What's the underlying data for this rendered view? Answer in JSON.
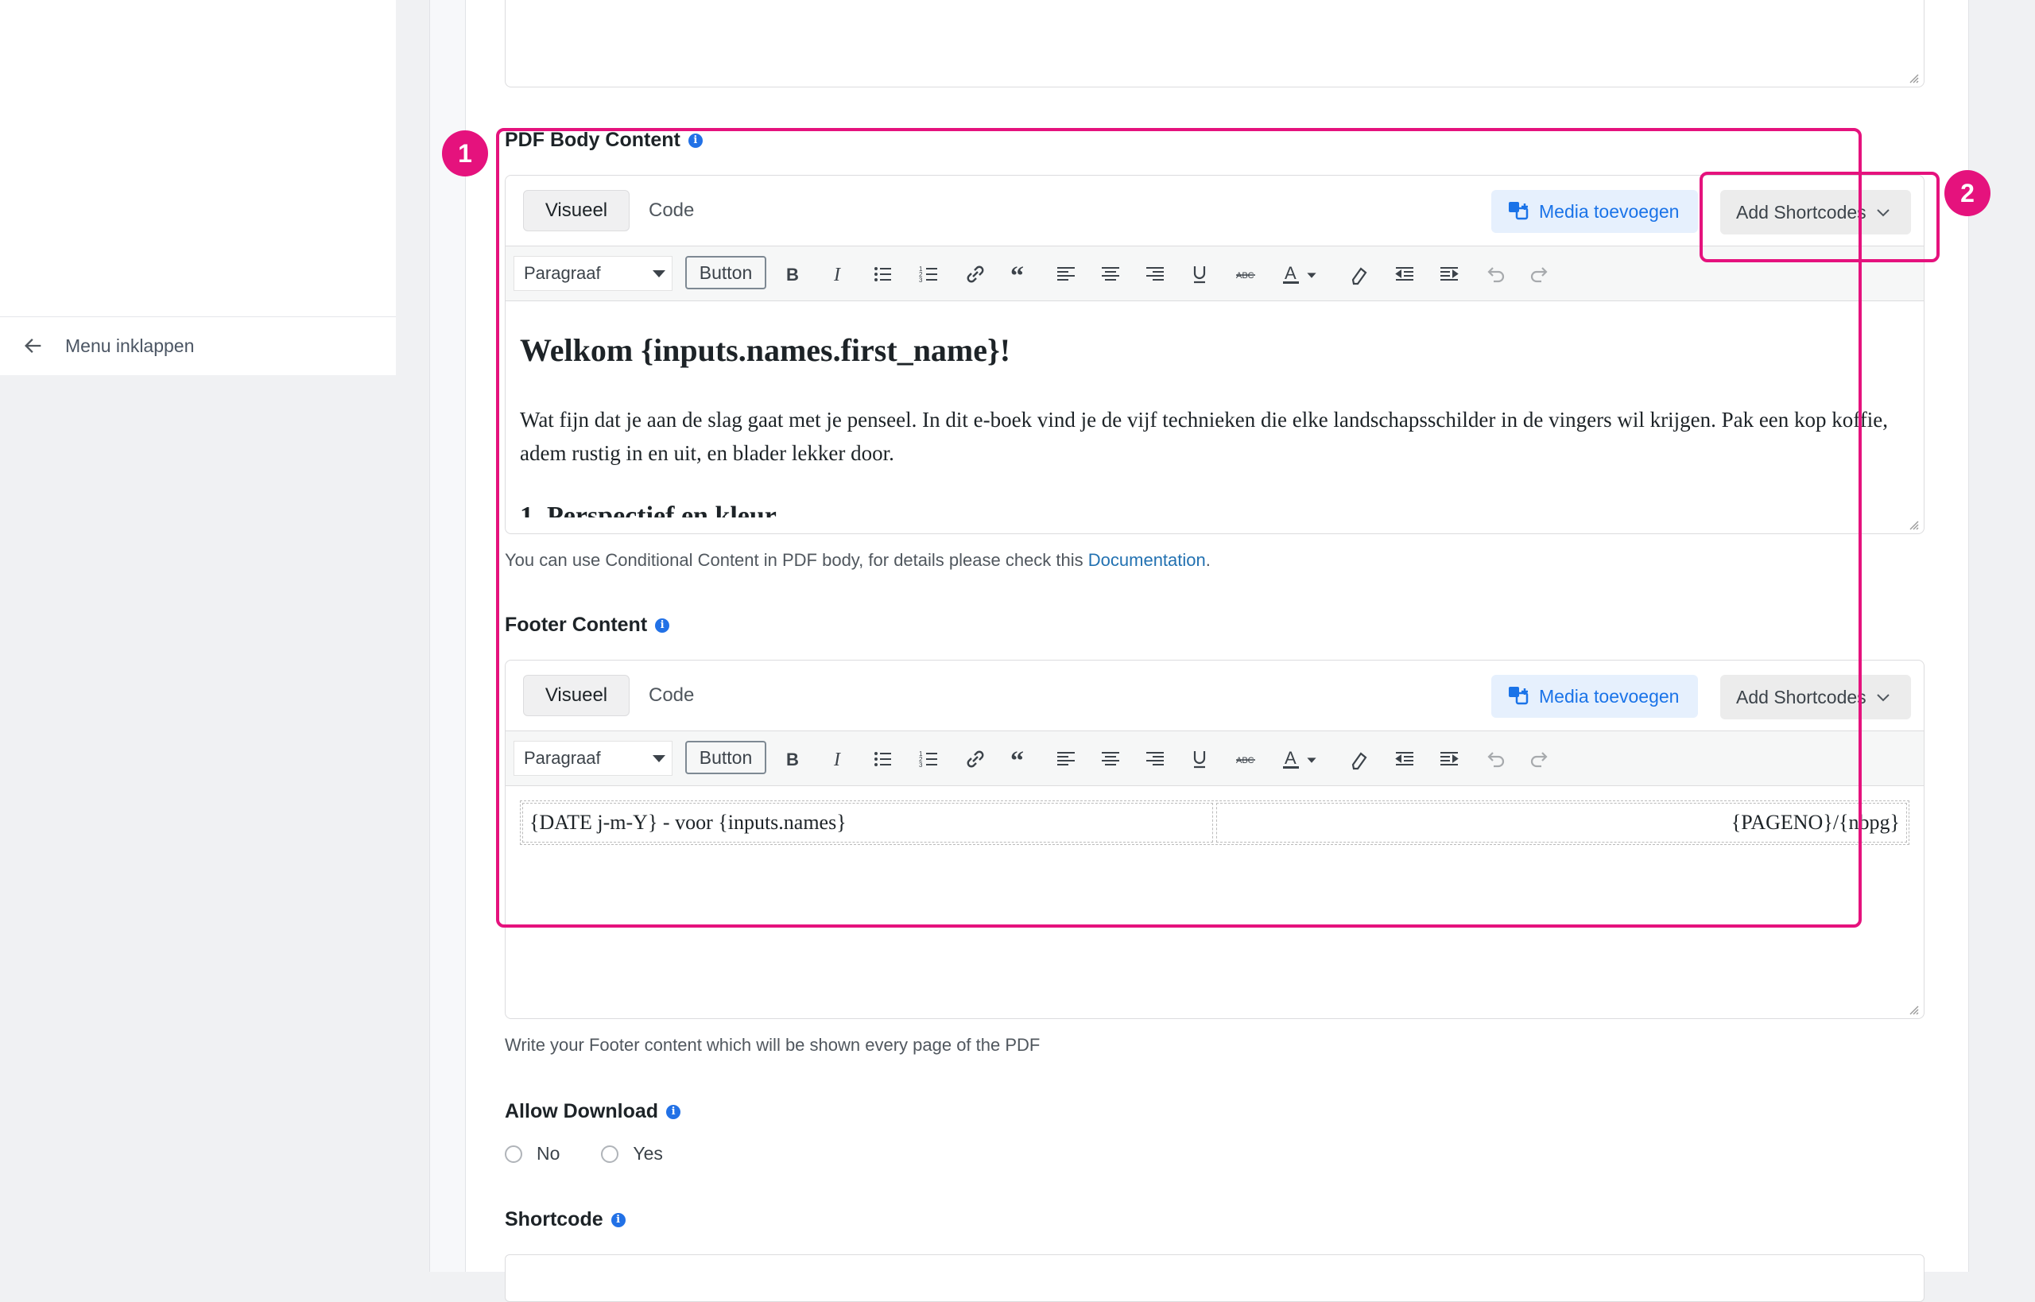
{
  "sidebar": {
    "collapse_label": "Menu inklappen"
  },
  "body_field": {
    "label": "PDF Body Content",
    "tabs": {
      "visual": "Visueel",
      "code": "Code"
    },
    "media_button": "Media toevoegen",
    "shortcodes_button": "Add Shortcodes",
    "format_select": "Paragraaf",
    "button_label": "Button",
    "heading": "Welkom {inputs.names.first_name}!",
    "paragraph": "Wat fijn dat je aan de slag gaat met je penseel. In dit e-boek vind je de vijf technieken die elke landschapsschilder in de vingers wil krijgen. Pak een kop koffie, adem rustig in en uit, en blader lekker door.",
    "help_prefix": "You can use Conditional Content in PDF body, for details please check this ",
    "help_link": "Documentation",
    "help_suffix": "."
  },
  "footer_field": {
    "label": "Footer Content",
    "tabs": {
      "visual": "Visueel",
      "code": "Code"
    },
    "media_button": "Media toevoegen",
    "shortcodes_button": "Add Shortcodes",
    "format_select": "Paragraaf",
    "button_label": "Button",
    "left_cell": "{DATE j-m-Y} - voor {inputs.names}",
    "right_cell": "{PAGENO}/{nbpg}",
    "help": "Write your Footer content which will be shown every page of the PDF"
  },
  "allow_download": {
    "label": "Allow Download",
    "options": [
      "No",
      "Yes"
    ]
  },
  "shortcode": {
    "label": "Shortcode"
  },
  "annotations": {
    "one": "1",
    "two": "2"
  },
  "colors": {
    "accent": "#e5127d",
    "link": "#2271b1",
    "media": "#1a73e8"
  },
  "icons": [
    "bold-icon",
    "italic-icon",
    "bullet-list-icon",
    "numbered-list-icon",
    "link-icon",
    "blockquote-icon",
    "align-left-icon",
    "align-center-icon",
    "align-right-icon",
    "underline-icon",
    "strikethrough-icon",
    "text-color-icon",
    "clear-format-icon",
    "outdent-icon",
    "indent-icon",
    "undo-icon",
    "redo-icon"
  ]
}
